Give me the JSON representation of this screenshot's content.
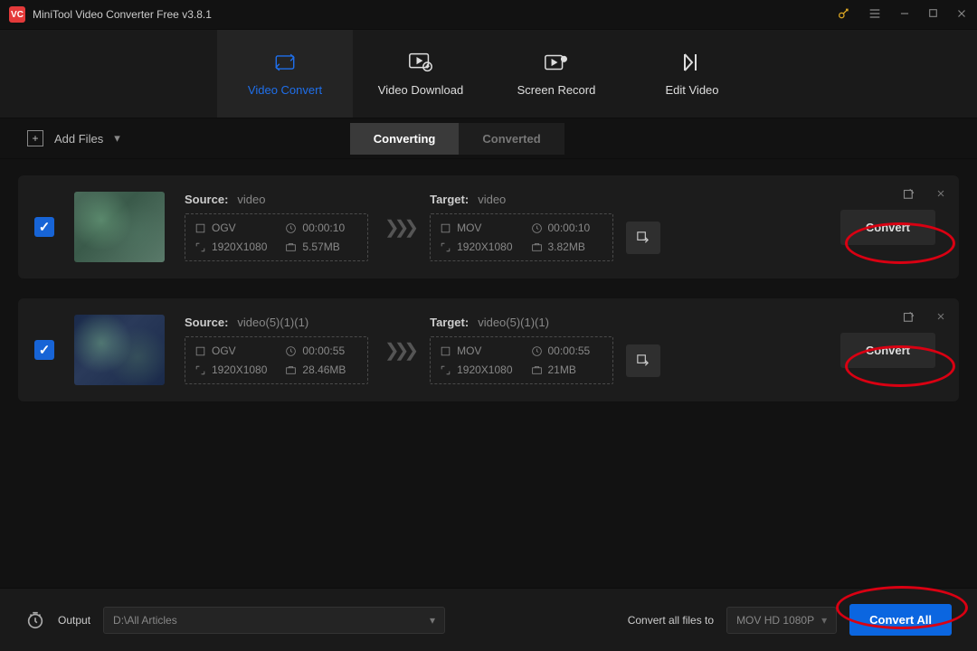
{
  "titlebar": {
    "app_title": "MiniTool Video Converter Free v3.8.1"
  },
  "nav": {
    "tabs": [
      {
        "label": "Video Convert"
      },
      {
        "label": "Video Download"
      },
      {
        "label": "Screen Record"
      },
      {
        "label": "Edit Video"
      }
    ]
  },
  "toolbar": {
    "add_files": "Add Files",
    "subtabs": [
      {
        "label": "Converting"
      },
      {
        "label": "Converted"
      }
    ]
  },
  "items": [
    {
      "checked": true,
      "source": {
        "label": "Source:",
        "name": "video",
        "format": "OGV",
        "duration": "00:00:10",
        "resolution": "1920X1080",
        "size": "5.57MB"
      },
      "target": {
        "label": "Target:",
        "name": "video",
        "format": "MOV",
        "duration": "00:00:10",
        "resolution": "1920X1080",
        "size": "3.82MB"
      },
      "convert_label": "Convert"
    },
    {
      "checked": true,
      "source": {
        "label": "Source:",
        "name": "video(5)(1)(1)",
        "format": "OGV",
        "duration": "00:00:55",
        "resolution": "1920X1080",
        "size": "28.46MB"
      },
      "target": {
        "label": "Target:",
        "name": "video(5)(1)(1)",
        "format": "MOV",
        "duration": "00:00:55",
        "resolution": "1920X1080",
        "size": "21MB"
      },
      "convert_label": "Convert"
    }
  ],
  "bottom": {
    "output_label": "Output",
    "output_path": "D:\\All Articles",
    "convert_all_to_label": "Convert all files to",
    "preset": "MOV HD 1080P",
    "convert_all_btn": "Convert All"
  }
}
